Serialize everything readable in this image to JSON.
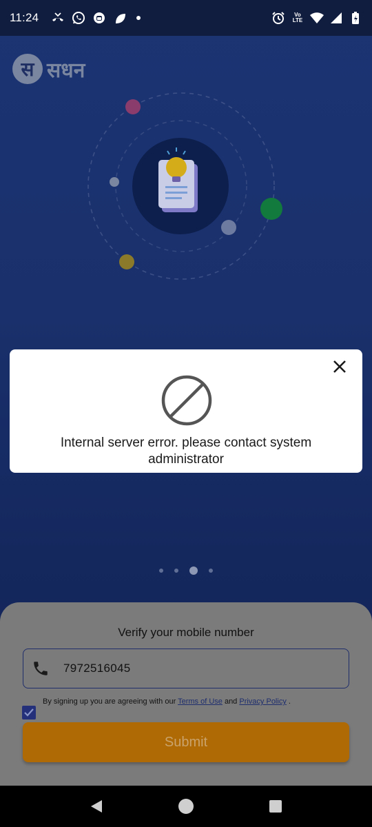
{
  "status_bar": {
    "time": "11:24",
    "left_icons": [
      "missed-call-icon",
      "whatsapp-icon",
      "app-icon",
      "leaf-icon",
      "notification-dot"
    ],
    "lte_label_top": "Vo",
    "lte_label_bottom": "LTE",
    "right_icons": [
      "alarm-icon",
      "volte-icon",
      "wifi-icon",
      "signal-icon",
      "battery-icon"
    ]
  },
  "app": {
    "logo_mark": "स",
    "logo_text": "सधन"
  },
  "pager": {
    "count": 4,
    "active_index": 2
  },
  "dialog": {
    "icon": "blocked-icon",
    "message": "Internal server error. please contact system administrator",
    "close_icon": "close-icon"
  },
  "verify": {
    "title": "Verify your mobile number",
    "phone_value": "7972516045",
    "terms_prefix": "By signing up you are agreeing with our ",
    "terms_link": "Terms of Use",
    "terms_and": " and ",
    "privacy_link": "Privacy Policy",
    "terms_suffix": " .",
    "checkbox_checked": true,
    "submit_label": "Submit"
  },
  "colors": {
    "background": "#1c3473",
    "accent_orange": "#b06a05",
    "dialog_bg": "#ffffff"
  }
}
